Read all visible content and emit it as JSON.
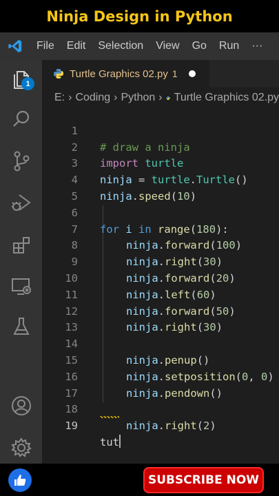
{
  "banner": {
    "title": "Ninja Design in Python"
  },
  "menubar": {
    "items": [
      "File",
      "Edit",
      "Selection",
      "View",
      "Go",
      "Run"
    ],
    "more": "···"
  },
  "activity": {
    "explorer_badge": "1"
  },
  "tab": {
    "name": "Turtle Graphics 02.py",
    "count": "1"
  },
  "breadcrumb": {
    "parts": [
      "E:",
      "Coding",
      "Python",
      "Turtle Graphics 02.py"
    ]
  },
  "code": {
    "line_numbers": [
      "1",
      "2",
      "3",
      "4",
      "5",
      "6",
      "7",
      "8",
      "9",
      "10",
      "11",
      "12",
      "13",
      "14",
      "15",
      "16",
      "17",
      "18",
      "19"
    ],
    "l1": "# draw a ninja",
    "l2_kw": "import",
    "l2_mod": "turtle",
    "l3_var": "ninja",
    "l3_eq": " = ",
    "l3_mod": "turtle",
    "l3_dot": ".",
    "l3_cls": "Turtle",
    "l3_args": "()",
    "l4_var": "ninja",
    "l4_dot": ".",
    "l4_fn": "speed",
    "l4_open": "(",
    "l4_num": "10",
    "l4_close": ")",
    "l6_for": "for",
    "l6_i": "i",
    "l6_in": "in",
    "l6_fn": "range",
    "l6_open": "(",
    "l6_num": "180",
    "l6_close": "):",
    "l7_fn": "forward",
    "l7_num": "100",
    "l8_fn": "right",
    "l8_num": "30",
    "l9_fn": "forward",
    "l9_num": "20",
    "l10_fn": "left",
    "l10_num": "60",
    "l11_fn": "forward",
    "l11_num": "50",
    "l12_fn": "right",
    "l12_num": "30",
    "l14_fn": "penup",
    "l15_fn": "setposition",
    "l15_a": "0",
    "l15_b": "0",
    "l16_fn": "pendown",
    "l18_fn": "right",
    "l18_num": "2",
    "l19": "tut",
    "obj": "ninja"
  },
  "footer": {
    "subscribe": "SUBSCRIBE NOW"
  },
  "colors": {
    "accent": "#007acc",
    "banner_text": "#f5c518",
    "subscribe_bg": "#cc0000"
  }
}
